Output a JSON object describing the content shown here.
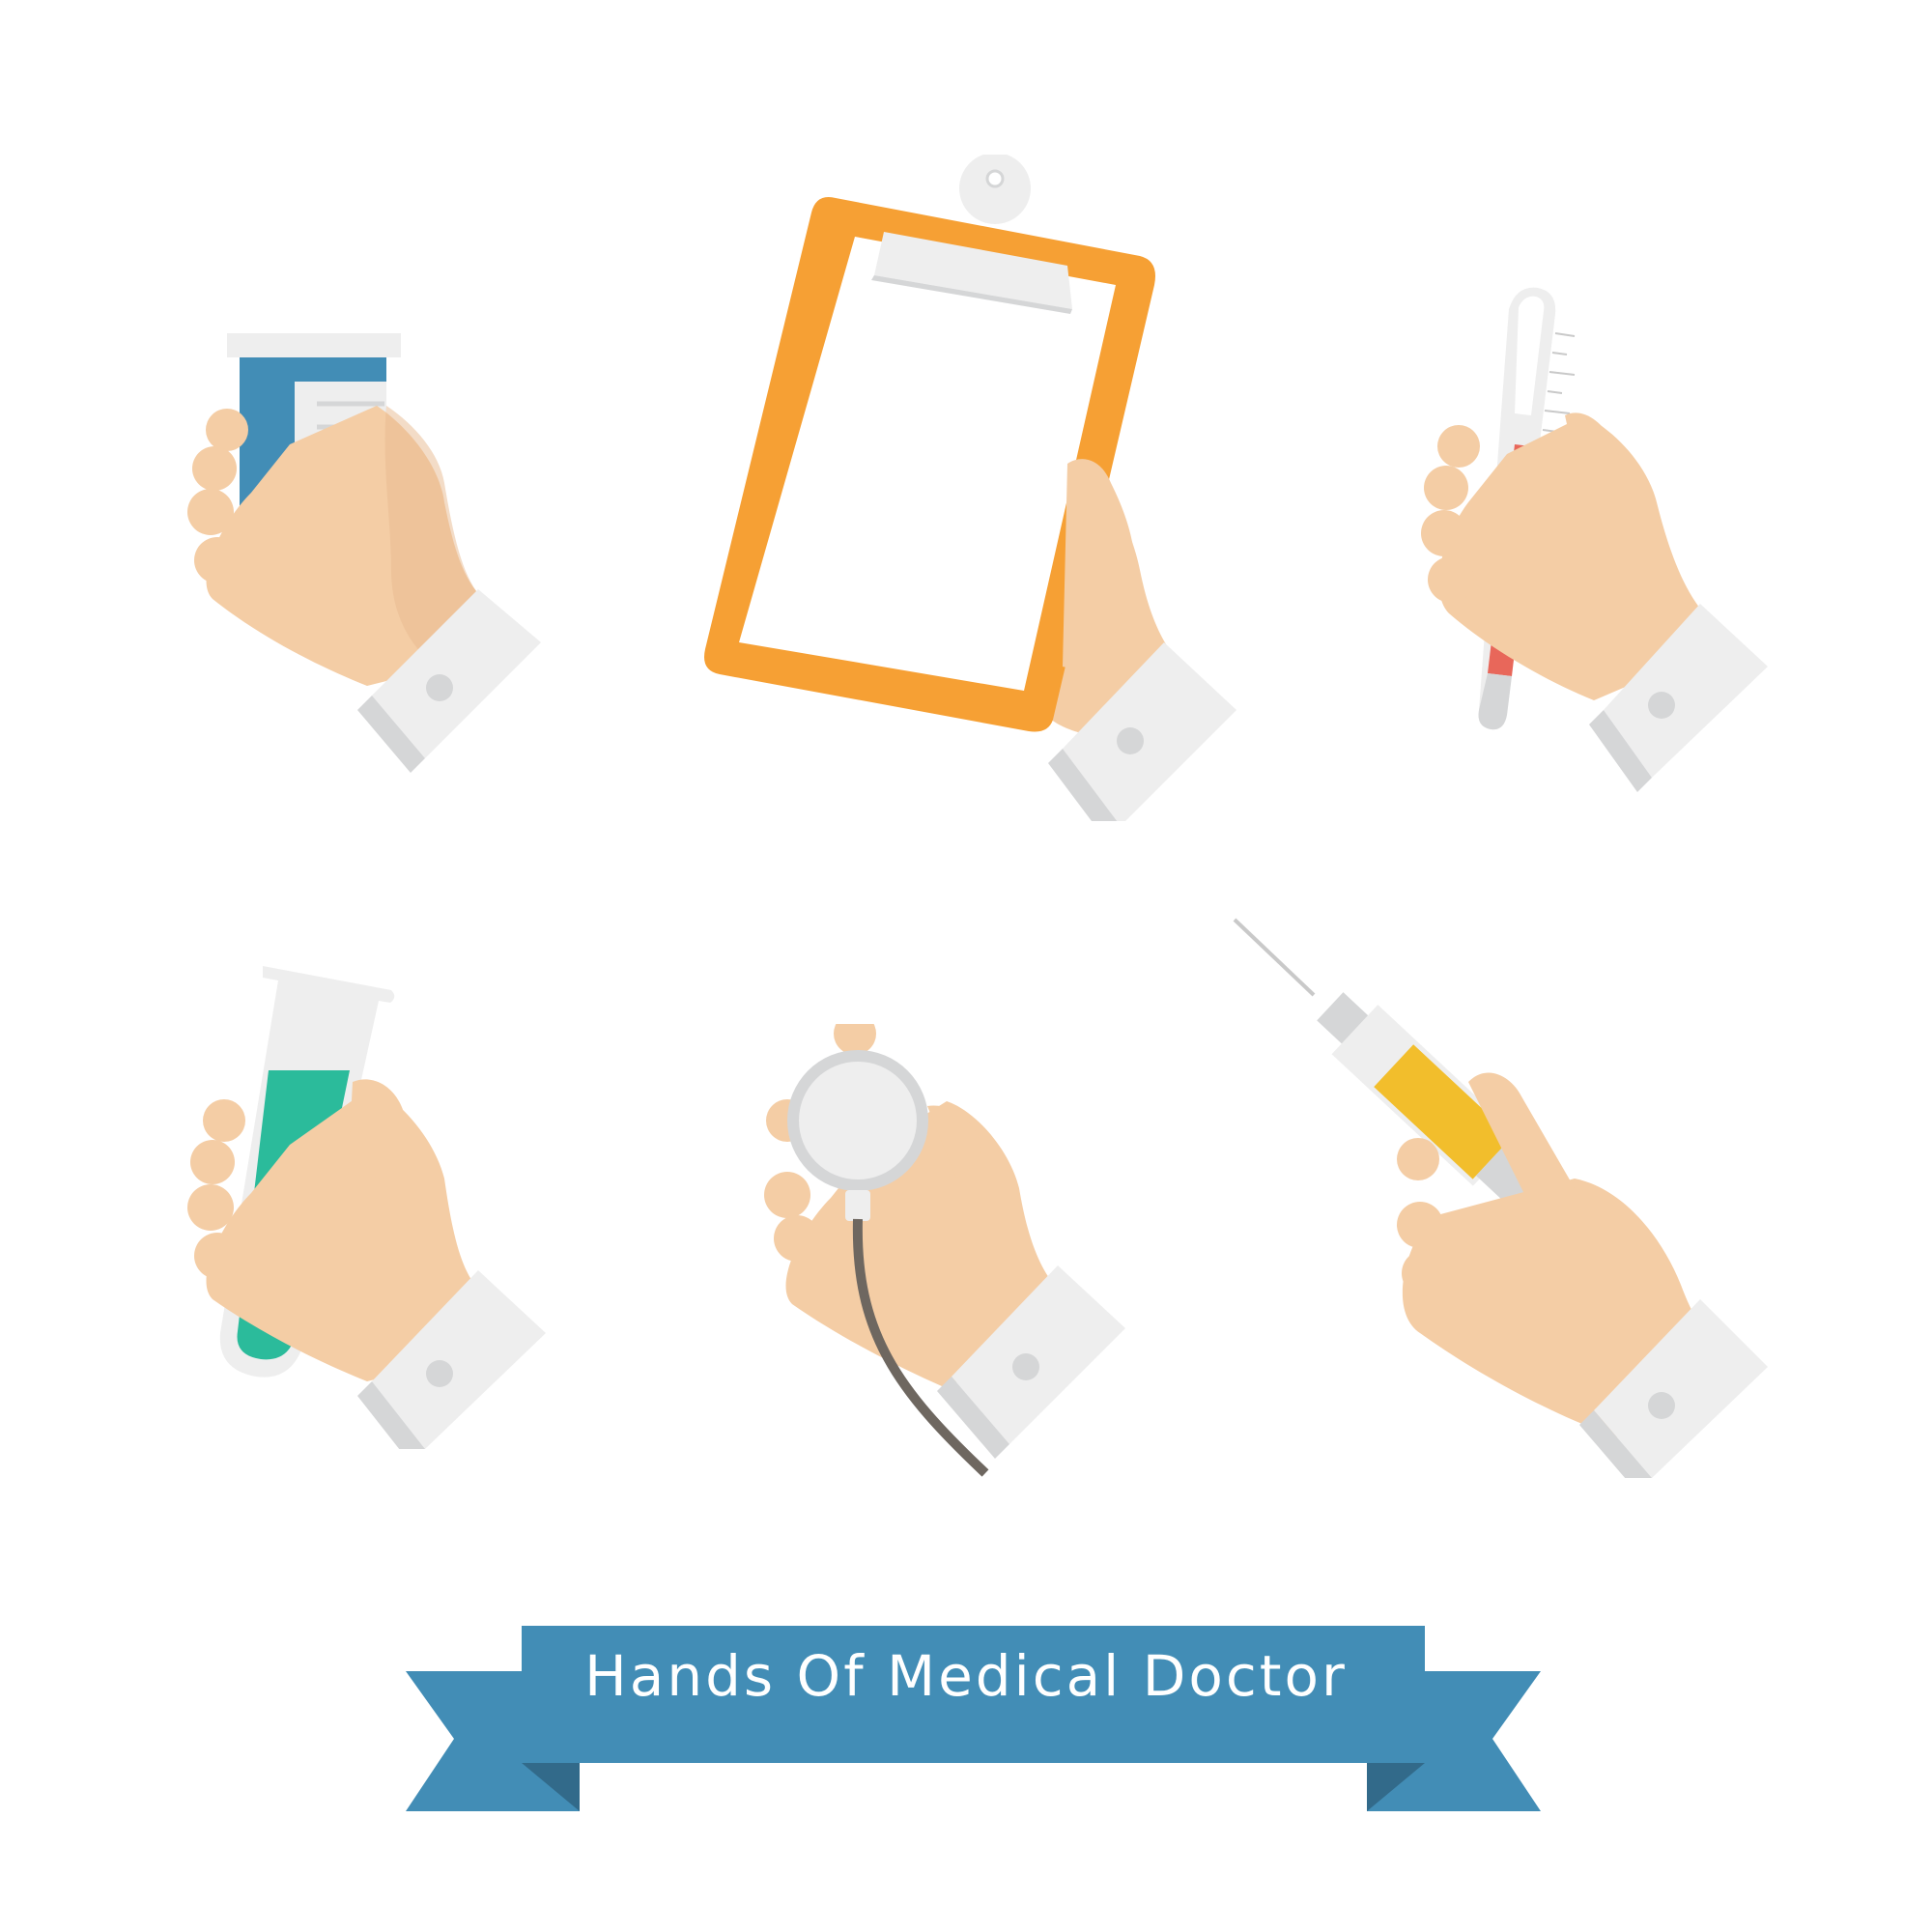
{
  "banner": {
    "title": "Hands Of Medical Doctor"
  },
  "colors": {
    "skin": "#F4CDA5",
    "skin_shadow": "#E8B98F",
    "sleeve": "#EEEEEE",
    "sleeve_shadow": "#D5D6D7",
    "button": "#D5D6D7",
    "ribbon": "#428DB6",
    "ribbon_dark": "#326A8A",
    "clipboard": "#F6A034",
    "bottle": "#428DB6",
    "thermometer_red": "#E8675A",
    "test_tube_green": "#2BBB9B",
    "syringe_yellow": "#F2BE2C",
    "stethoscope_tube": "#6E6760"
  },
  "icons": [
    {
      "name": "hand-holding-medicine-bottle"
    },
    {
      "name": "hand-holding-clipboard"
    },
    {
      "name": "hand-holding-thermometer"
    },
    {
      "name": "hand-holding-test-tube"
    },
    {
      "name": "hand-holding-stethoscope"
    },
    {
      "name": "hand-holding-syringe"
    }
  ]
}
